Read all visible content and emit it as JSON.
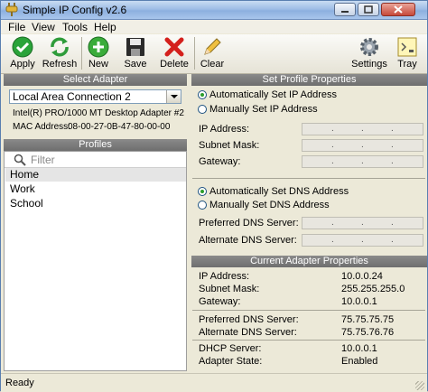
{
  "window": {
    "title": "Simple IP Config v2.6"
  },
  "menu": [
    "File",
    "View",
    "Tools",
    "Help"
  ],
  "toolbar": {
    "apply": "Apply",
    "refresh": "Refresh",
    "new": "New",
    "save": "Save",
    "delete": "Delete",
    "clear": "Clear",
    "settings": "Settings",
    "tray": "Tray"
  },
  "select_adapter": {
    "header": "Select Adapter",
    "selected": "Local Area Connection 2",
    "description": "Intel(R) PRO/1000 MT Desktop Adapter #2",
    "mac_label": "MAC Address:",
    "mac_value": "08-00-27-0B-47-80-00-00"
  },
  "profiles": {
    "header": "Profiles",
    "filter_placeholder": "Filter",
    "items": [
      "Home",
      "Work",
      "School"
    ]
  },
  "set_profile": {
    "header": "Set Profile Properties",
    "auto_ip": "Automatically Set IP Address",
    "manual_ip": "Manually Set IP Address",
    "ip_label": "IP Address:",
    "subnet_label": "Subnet Mask:",
    "gateway_label": "Gateway:",
    "auto_dns": "Automatically Set DNS Address",
    "manual_dns": "Manually Set DNS Address",
    "pref_dns_label": "Preferred DNS Server:",
    "alt_dns_label": "Alternate DNS Server:"
  },
  "current": {
    "header": "Current Adapter Properties",
    "rows": [
      {
        "label": "IP Address:",
        "value": "10.0.0.24"
      },
      {
        "label": "Subnet Mask:",
        "value": "255.255.255.0"
      },
      {
        "label": "Gateway:",
        "value": "10.0.0.1"
      },
      {
        "label": "Preferred DNS Server:",
        "value": "75.75.75.75"
      },
      {
        "label": "Alternate DNS Server:",
        "value": "75.75.76.76"
      },
      {
        "label": "DHCP Server:",
        "value": "10.0.0.1"
      },
      {
        "label": "Adapter State:",
        "value": "Enabled"
      }
    ]
  },
  "status": {
    "text": "Ready"
  },
  "colors": {
    "header_bg": "#7a7a7a",
    "radio_dot": "#2c9d2c",
    "apply_green": "#2aa33a",
    "delete_red": "#d4201c"
  }
}
